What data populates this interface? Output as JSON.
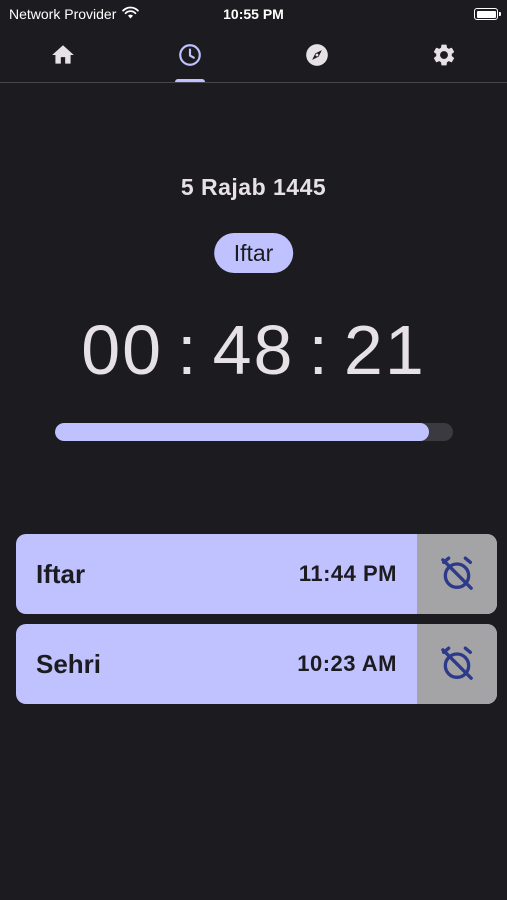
{
  "status_bar": {
    "carrier": "Network Provider",
    "time": "10:55 PM"
  },
  "tabs": [
    {
      "name": "home",
      "icon": "home-icon",
      "active": false
    },
    {
      "name": "schedule",
      "icon": "clock-icon",
      "active": true
    },
    {
      "name": "qibla",
      "icon": "compass-icon",
      "active": false
    },
    {
      "name": "settings",
      "icon": "gear-icon",
      "active": false
    }
  ],
  "main": {
    "hijri_date": "5 Rajab 1445",
    "next_event": "Iftar",
    "countdown": {
      "hours": "00",
      "minutes": "48",
      "seconds": "21",
      "separator": ":"
    },
    "progress_fraction": 0.94
  },
  "prayers": [
    {
      "name": "Iftar",
      "time": "11:44 PM",
      "alarm_icon": "alarm-off-icon"
    },
    {
      "name": "Sehri",
      "time": "10:23 AM",
      "alarm_icon": "alarm-off-icon"
    }
  ],
  "colors": {
    "background": "#1c1b1f",
    "accent": "#bfc2ff",
    "icon_inactive": "#e6e1e5",
    "alarm_bg": "#a4a4a6",
    "alarm_icon": "#2d3a8c"
  }
}
